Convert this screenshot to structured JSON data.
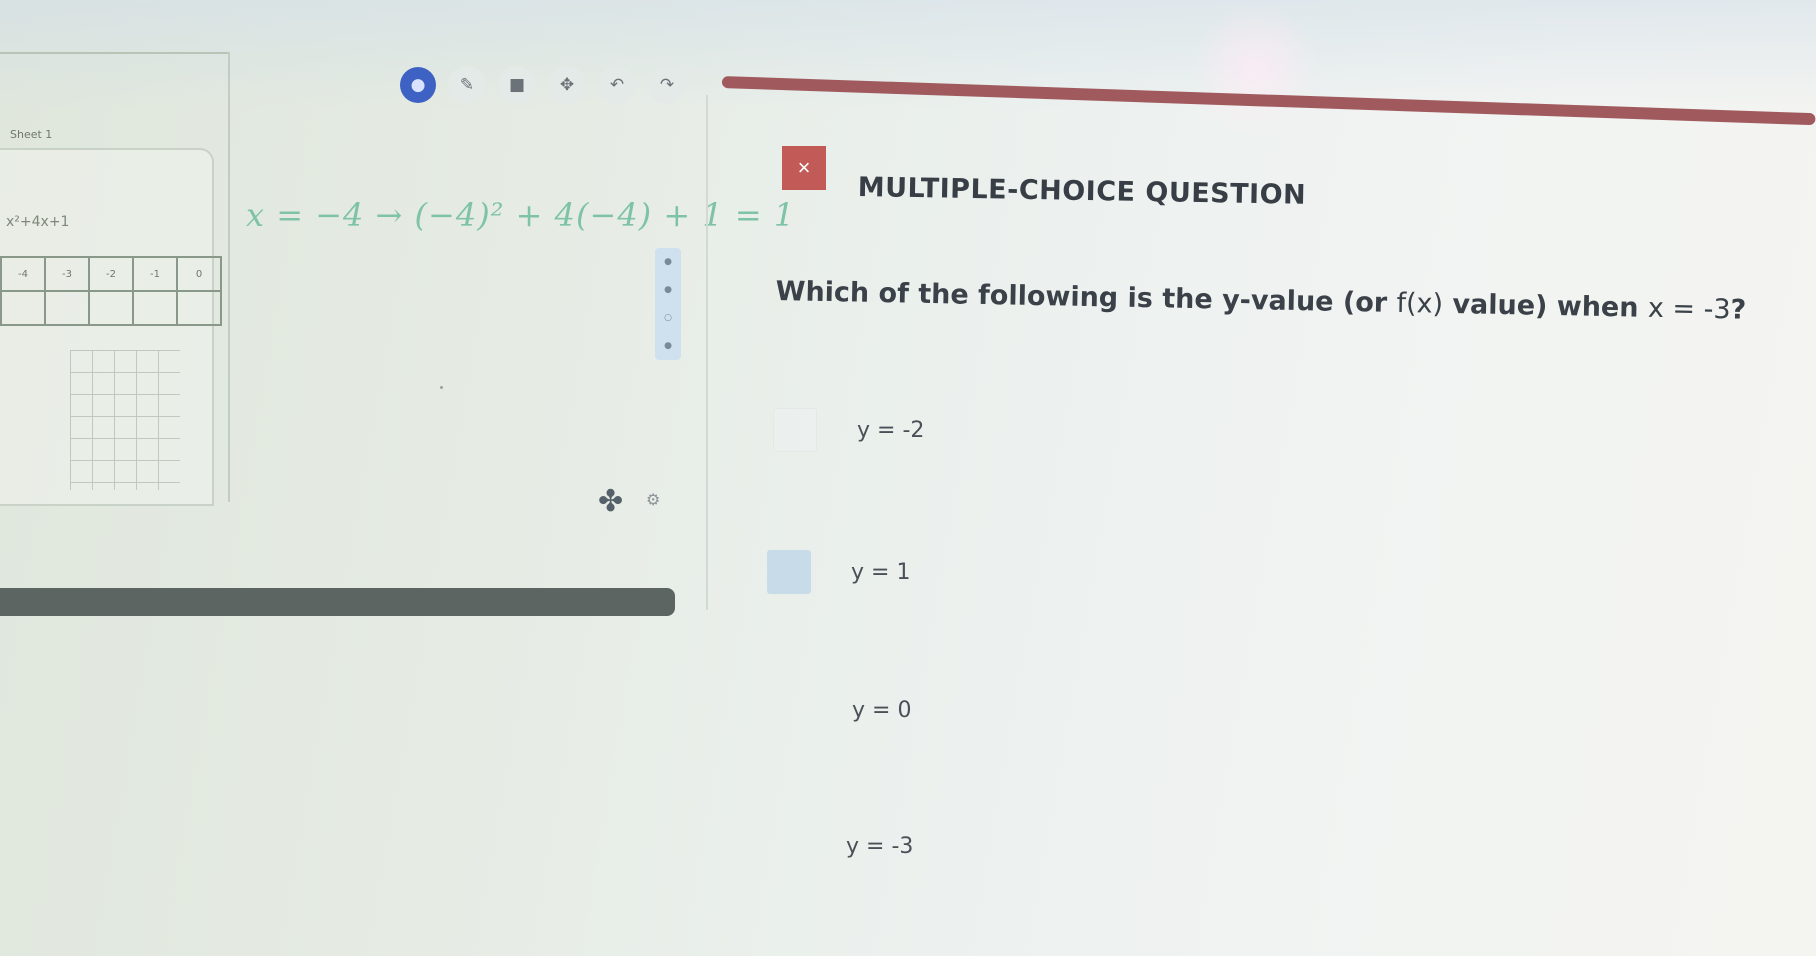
{
  "toolbar": {
    "tools": [
      {
        "icon": "circle-pen-icon",
        "glyph": "●"
      },
      {
        "icon": "pencil-icon",
        "glyph": "✎"
      },
      {
        "icon": "square-icon",
        "glyph": "■"
      },
      {
        "icon": "move-icon",
        "glyph": "✥"
      },
      {
        "icon": "undo-icon",
        "glyph": "↶"
      },
      {
        "icon": "redo-icon",
        "glyph": "↷"
      }
    ]
  },
  "left_panel": {
    "sheet_name": "Sheet 1",
    "function_label": "x²+4x+1",
    "table_row": [
      "-4",
      "-3",
      "-2",
      "-1",
      "0"
    ]
  },
  "handwriting": "x = −4 → (−4)² + 4(−4) + 1 = 1",
  "question": {
    "close_glyph": "×",
    "header": "MULTIPLE-CHOICE QUESTION",
    "prompt_prefix": "Which of the following is the y-value (or ",
    "prompt_fx": "f(x)",
    "prompt_mid": " value) when ",
    "prompt_x": "x = -3",
    "prompt_end": "?",
    "options": [
      {
        "label": "y = -2",
        "checked": false
      },
      {
        "label": "y = 1",
        "checked": true
      },
      {
        "label": "y = 0",
        "checked": false
      },
      {
        "label": "y = -3",
        "checked": false
      }
    ]
  },
  "colors": {
    "accent_blue": "#3e62c4",
    "close_red": "#c25a57",
    "top_bar": "#a05a5e",
    "handwriting_green": "#7fc3a7"
  }
}
